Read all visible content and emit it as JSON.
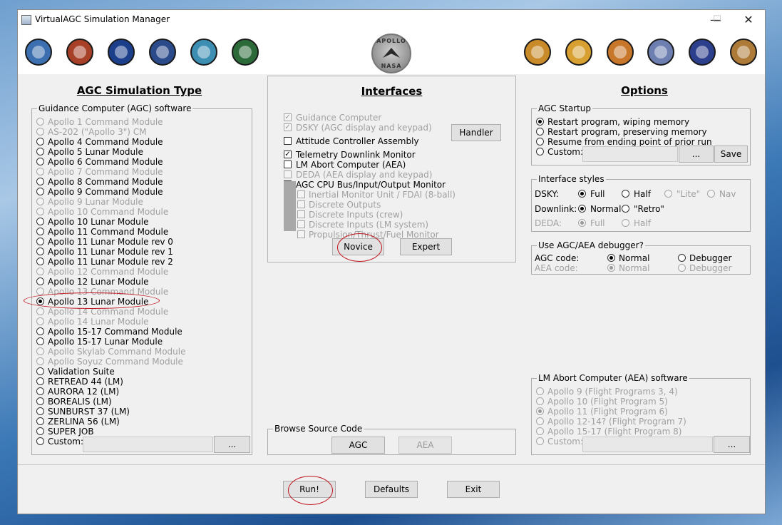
{
  "window": {
    "title": "VirtualAGC Simulation Manager",
    "minimize": "—",
    "maximize": "☐",
    "close": "✕"
  },
  "banner": {
    "left_patches": [
      "#3b6fb0",
      "#a84028",
      "#1c3f8c",
      "#2a4a8a",
      "#3c8fb3",
      "#2c6a3a"
    ],
    "right_patches": [
      "#c98a2a",
      "#d8a030",
      "#c8762a",
      "#6c7fb0",
      "#2c3f8c",
      "#ad7a38"
    ],
    "logo_top": "APOLLO",
    "logo_bottom": "NASA"
  },
  "agc_panel": {
    "title": "AGC Simulation Type",
    "group_label": "Guidance Computer (AGC) software",
    "items": [
      {
        "label": "Apollo 1 Command Module",
        "enabled": false,
        "selected": false
      },
      {
        "label": "AS-202 (\"Apollo 3\") CM",
        "enabled": false,
        "selected": false
      },
      {
        "label": "Apollo 4 Command Module",
        "enabled": true,
        "selected": false
      },
      {
        "label": "Apollo 5 Lunar Module",
        "enabled": true,
        "selected": false
      },
      {
        "label": "Apollo 6 Command Module",
        "enabled": true,
        "selected": false
      },
      {
        "label": "Apollo 7 Command Module",
        "enabled": false,
        "selected": false
      },
      {
        "label": "Apollo 8 Command Module",
        "enabled": true,
        "selected": false
      },
      {
        "label": "Apollo 9 Command Module",
        "enabled": true,
        "selected": false
      },
      {
        "label": "Apollo 9 Lunar Module",
        "enabled": false,
        "selected": false
      },
      {
        "label": "Apollo 10 Command Module",
        "enabled": false,
        "selected": false
      },
      {
        "label": "Apollo 10 Lunar Module",
        "enabled": true,
        "selected": false
      },
      {
        "label": "Apollo 11 Command Module",
        "enabled": true,
        "selected": false
      },
      {
        "label": "Apollo 11 Lunar Module rev 0",
        "enabled": true,
        "selected": false
      },
      {
        "label": "Apollo 11 Lunar Module rev 1",
        "enabled": true,
        "selected": false
      },
      {
        "label": "Apollo 11 Lunar Module rev 2",
        "enabled": true,
        "selected": false
      },
      {
        "label": "Apollo 12 Command Module",
        "enabled": false,
        "selected": false
      },
      {
        "label": "Apollo 12 Lunar Module",
        "enabled": true,
        "selected": false
      },
      {
        "label": "Apollo 13 Command Module",
        "enabled": false,
        "selected": false
      },
      {
        "label": "Apollo 13 Lunar Module",
        "enabled": true,
        "selected": true
      },
      {
        "label": "Apollo 14 Command Module",
        "enabled": false,
        "selected": false
      },
      {
        "label": "Apollo 14 Lunar Module",
        "enabled": false,
        "selected": false
      },
      {
        "label": "Apollo 15-17 Command Module",
        "enabled": true,
        "selected": false
      },
      {
        "label": "Apollo 15-17 Lunar Module",
        "enabled": true,
        "selected": false
      },
      {
        "label": "Apollo Skylab Command Module",
        "enabled": false,
        "selected": false
      },
      {
        "label": "Apollo Soyuz Command Module",
        "enabled": false,
        "selected": false
      },
      {
        "label": "Validation Suite",
        "enabled": true,
        "selected": false
      },
      {
        "label": "RETREAD 44 (LM)",
        "enabled": true,
        "selected": false
      },
      {
        "label": "AURORA 12 (LM)",
        "enabled": true,
        "selected": false
      },
      {
        "label": "BOREALIS (LM)",
        "enabled": true,
        "selected": false
      },
      {
        "label": "SUNBURST 37 (LM)",
        "enabled": true,
        "selected": false
      },
      {
        "label": "ZERLINA 56 (LM)",
        "enabled": true,
        "selected": false
      },
      {
        "label": "SUPER JOB",
        "enabled": true,
        "selected": false
      },
      {
        "label": "Custom:",
        "enabled": true,
        "selected": false
      }
    ],
    "custom_value": "",
    "browse_label": "..."
  },
  "interfaces": {
    "title": "Interfaces",
    "items": [
      {
        "label": "Guidance Computer",
        "checked": true,
        "enabled": false
      },
      {
        "label": "DSKY (AGC display and keypad)",
        "checked": true,
        "enabled": false
      },
      {
        "label": "Attitude Controller Assembly",
        "checked": false,
        "enabled": true
      },
      {
        "label": "Telemetry Downlink Monitor",
        "checked": true,
        "enabled": true
      },
      {
        "label": "LM Abort Computer (AEA)",
        "checked": false,
        "enabled": true
      },
      {
        "label": "DEDA (AEA display and keypad)",
        "checked": false,
        "enabled": false
      },
      {
        "label": "AGC CPU Bus/Input/Output Monitor",
        "checked": false,
        "enabled": true
      }
    ],
    "sub_items": [
      "Inertial Monitor Unit / FDAI (8-ball)",
      "Discrete Outputs",
      "Discrete Inputs (crew)",
      "Discrete Inputs (LM system)",
      "Propulsion/Thrust/Fuel Monitor"
    ],
    "handler_label": "Handler",
    "novice_label": "Novice",
    "expert_label": "Expert",
    "browse_group": "Browse Source Code",
    "agc_label": "AGC",
    "aea_label": "AEA"
  },
  "options": {
    "title": "Options",
    "startup": {
      "label": "AGC Startup",
      "items": [
        {
          "label": "Restart program, wiping memory",
          "selected": true
        },
        {
          "label": "Restart program, preserving memory",
          "selected": false
        },
        {
          "label": "Resume from ending point of prior run",
          "selected": false
        },
        {
          "label": "Custom:",
          "selected": false
        }
      ],
      "custom_value": "",
      "browse_label": "...",
      "save_label": "Save"
    },
    "interface_styles": {
      "label": "Interface styles",
      "dsky_label": "DSKY:",
      "dsky_options": [
        "Full",
        "Half",
        "\"Lite\"",
        "Nav"
      ],
      "downlink_label": "Downlink:",
      "downlink_options": [
        "Normal",
        "\"Retro\""
      ],
      "deda_label": "DEDA:",
      "deda_options": [
        "Full",
        "Half"
      ]
    },
    "debugger": {
      "label": "Use AGC/AEA debugger?",
      "agc_code_label": "AGC code:",
      "aea_code_label": "AEA code:",
      "normal_label": "Normal",
      "debugger_label": "Debugger"
    },
    "aea": {
      "label": "LM Abort Computer (AEA) software",
      "items": [
        {
          "label": "Apollo 9 (Flight Programs 3, 4)",
          "selected": false
        },
        {
          "label": "Apollo 10 (Flight Program 5)",
          "selected": false
        },
        {
          "label": "Apollo 11 (Flight Program 6)",
          "selected": true
        },
        {
          "label": "Apollo 12-14? (Flight Program 7)",
          "selected": false
        },
        {
          "label": "Apollo 15-17 (Flight Program 8)",
          "selected": false
        },
        {
          "label": "Custom:",
          "selected": false
        }
      ],
      "custom_value": "",
      "browse_label": "..."
    }
  },
  "footer": {
    "run_label": "Run!",
    "defaults_label": "Defaults",
    "exit_label": "Exit"
  },
  "annotation_color": "#c0141c"
}
